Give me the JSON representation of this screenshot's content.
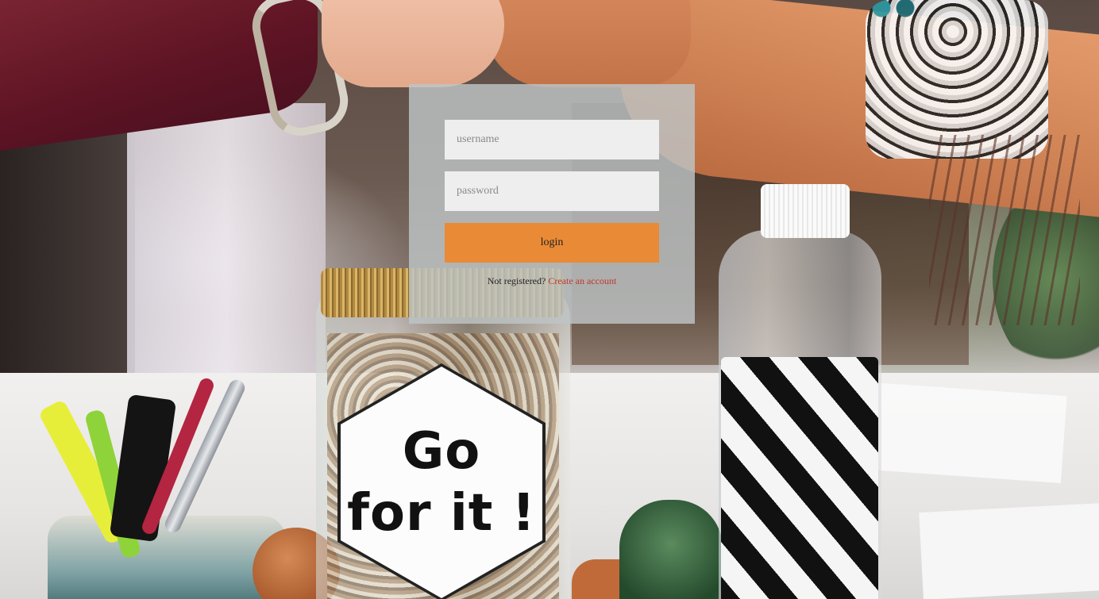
{
  "background": {
    "description_icon": "photo-background-fist-bump",
    "jar_label": {
      "line1": "Go",
      "line2": "for it !"
    }
  },
  "login_form": {
    "username_placeholder": "username",
    "password_placeholder": "password",
    "login_label": "login",
    "not_registered_text": "Not registered?",
    "create_account_label": "Create an account"
  },
  "colors": {
    "button": "#e88a36",
    "link": "#c0392b",
    "panel": "rgba(190,196,198,0.82)",
    "input": "#eeeeee"
  }
}
